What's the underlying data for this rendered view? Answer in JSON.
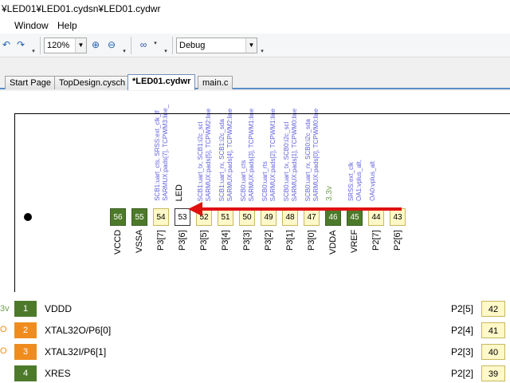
{
  "window": {
    "title": "¥LED01¥LED01.cydsn¥LED01.cydwr"
  },
  "menu": {
    "items": [
      "Window",
      "Help"
    ]
  },
  "toolbar": {
    "zoom_value": "120%",
    "config_value": "Debug",
    "undo_icon": "undo-icon",
    "redo_icon": "redo-icon",
    "zoom_in_icon": "zoom-in-icon",
    "zoom_out_icon": "zoom-out-icon",
    "find_icon": "binoculars-icon"
  },
  "tabs": [
    "Start Page",
    "TopDesign.cysch",
    "*LED01.cydwr",
    "main.c"
  ],
  "active_tab": "*LED01.cydwr",
  "colors": {
    "pin_power": "#4d7a2a",
    "pin_io": "#fff8c8",
    "pin_orange": "#f08c1e",
    "arrow": "#e01010",
    "annotation": "#6060e0"
  },
  "top_pins": [
    {
      "num": "56",
      "name": "VCCD",
      "ann": ""
    },
    {
      "num": "55",
      "name": "VSSA",
      "ann": ""
    },
    {
      "num": "54",
      "name": "P3[7]",
      "ann": "SCB1:uart_cts, SRSS:ext_clk_lf\nSARMUX:pads[7], TCPWM3:line_"
    },
    {
      "num": "53",
      "name": "P3[6]",
      "ann": "LED"
    },
    {
      "num": "52",
      "name": "P3[5]",
      "ann": "SCB1:uart_tx, SCB1:i2c_scl\nSARMUX:pads[5], TCPWM2:line"
    },
    {
      "num": "51",
      "name": "P3[4]",
      "ann": "SCB1:uart_rx, SCB1:i2c_sda\nSARMUX:pads[4], TCPWM2:line"
    },
    {
      "num": "50",
      "name": "P3[3]",
      "ann": "SCB0:uart_cts\nSARMUX:pads[3], TCPWM1:line"
    },
    {
      "num": "49",
      "name": "P3[2]",
      "ann": "SCB0:uart_rts\nSARMUX:pads[2], TCPWM1:line"
    },
    {
      "num": "48",
      "name": "P3[1]",
      "ann": "SCB0:uart_tx, SCB0:i2c_scl\nSARMUX:pads[1], TCPWM0:line"
    },
    {
      "num": "47",
      "name": "P3[0]",
      "ann": "SCB0:uart_rx, SCB0:i2c_sda\nSARMUX:pads[0], TCPWM0:line"
    },
    {
      "num": "46",
      "name": "VDDA",
      "ann": "3.3v"
    },
    {
      "num": "45",
      "name": "VREF",
      "ann": "SRSS:ext_clk\nOA1:vplus_alt,"
    },
    {
      "num": "44",
      "name": "P2[7]",
      "ann": "OA0:vplus_alt"
    },
    {
      "num": "43",
      "name": "P2[6]",
      "ann": ""
    }
  ],
  "left_pins": [
    {
      "num": "1",
      "name": "VDDD",
      "edge": "3v"
    },
    {
      "num": "2",
      "name": "XTAL32O/P6[0]",
      "edge": "O"
    },
    {
      "num": "3",
      "name": "XTAL32I/P6[1]",
      "edge": "O"
    },
    {
      "num": "4",
      "name": "XRES",
      "edge": ""
    }
  ],
  "right_pins": [
    {
      "num": "42",
      "name": "P2[5]"
    },
    {
      "num": "41",
      "name": "P2[4]"
    },
    {
      "num": "40",
      "name": "P2[3]"
    },
    {
      "num": "39",
      "name": "P2[2]"
    }
  ]
}
